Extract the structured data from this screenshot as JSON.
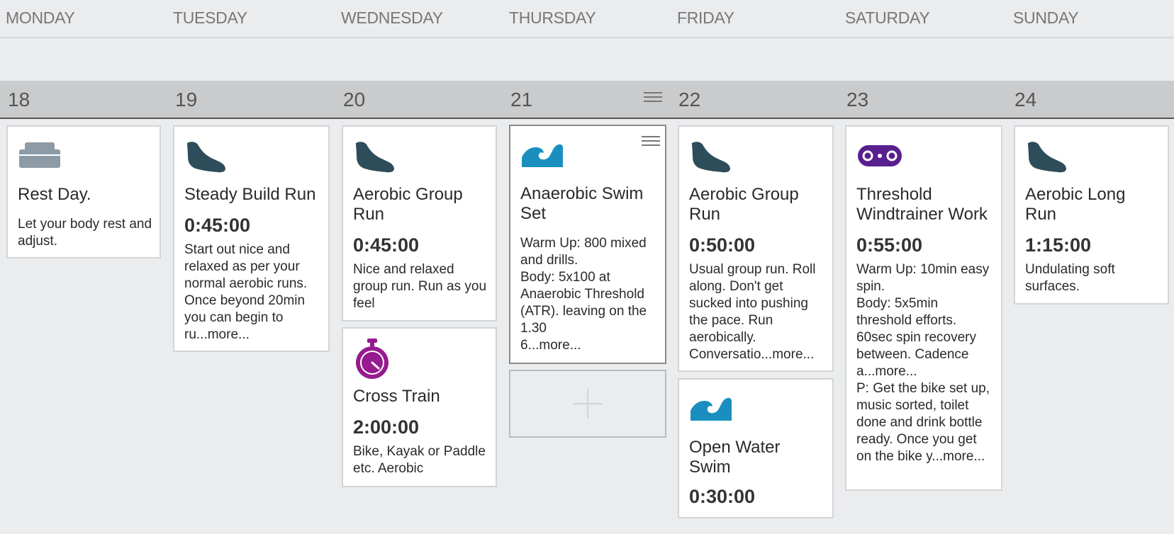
{
  "weekdays": [
    "MONDAY",
    "TUESDAY",
    "WEDNESDAY",
    "THURSDAY",
    "FRIDAY",
    "SATURDAY",
    "SUNDAY"
  ],
  "dates": [
    "18",
    "19",
    "20",
    "21",
    "22",
    "23",
    "24"
  ],
  "colors": {
    "run_icon": "#2e4d5a",
    "swim_icon": "#1a8fbf",
    "cross_train_icon": "#951b8e",
    "bike_icon": "#5a1f8f",
    "rest_icon": "#8c9ba6"
  },
  "workouts": {
    "mon_rest": {
      "icon": "couch-icon",
      "title": "Rest Day.",
      "description": "Let your body rest and adjust."
    },
    "tue_steady": {
      "icon": "run-shoe-icon",
      "title": "Steady Build Run",
      "duration": "0:45:00",
      "description": "Start out nice and relaxed as per your normal aerobic runs. Once beyond 20min you can begin to ru...more..."
    },
    "wed_group": {
      "icon": "run-shoe-icon",
      "title": "Aerobic Group Run",
      "duration": "0:45:00",
      "description": "Nice and relaxed group run. Run as you feel"
    },
    "wed_cross": {
      "icon": "stopwatch-icon",
      "title": "Cross Train",
      "duration": "2:00:00",
      "description": "Bike, Kayak or Paddle etc. Aerobic"
    },
    "thu_swim": {
      "icon": "wave-icon",
      "title": "Anaerobic Swim Set",
      "description_lines": [
        "Warm Up: 800 mixed and drills.",
        "Body: 5x100 at Anaerobic Threshold (ATR). leaving on the 1.30",
        "6...more..."
      ]
    },
    "fri_group": {
      "icon": "run-shoe-icon",
      "title": "Aerobic Group Run",
      "duration": "0:50:00",
      "description": "Usual group run. Roll along. Don't get sucked into pushing the pace. Run aerobically. Conversatio...more..."
    },
    "fri_swim": {
      "icon": "wave-icon",
      "title": "Open Water Swim",
      "duration": "0:30:00"
    },
    "sat_threshold": {
      "icon": "bike-chain-icon",
      "title": "Threshold Windtrainer Work",
      "duration": "0:55:00",
      "description_lines": [
        "Warm Up: 10min easy spin.",
        "Body: 5x5min threshold efforts. 60sec spin recovery between. Cadence a...more...",
        "P: Get the bike set up, music sorted, toilet done and drink bottle ready. Once you get on the bike y...more..."
      ]
    },
    "sun_long": {
      "icon": "run-shoe-icon",
      "title": "Aerobic Long Run",
      "duration": "1:15:00",
      "description": "Undulating soft surfaces."
    }
  }
}
